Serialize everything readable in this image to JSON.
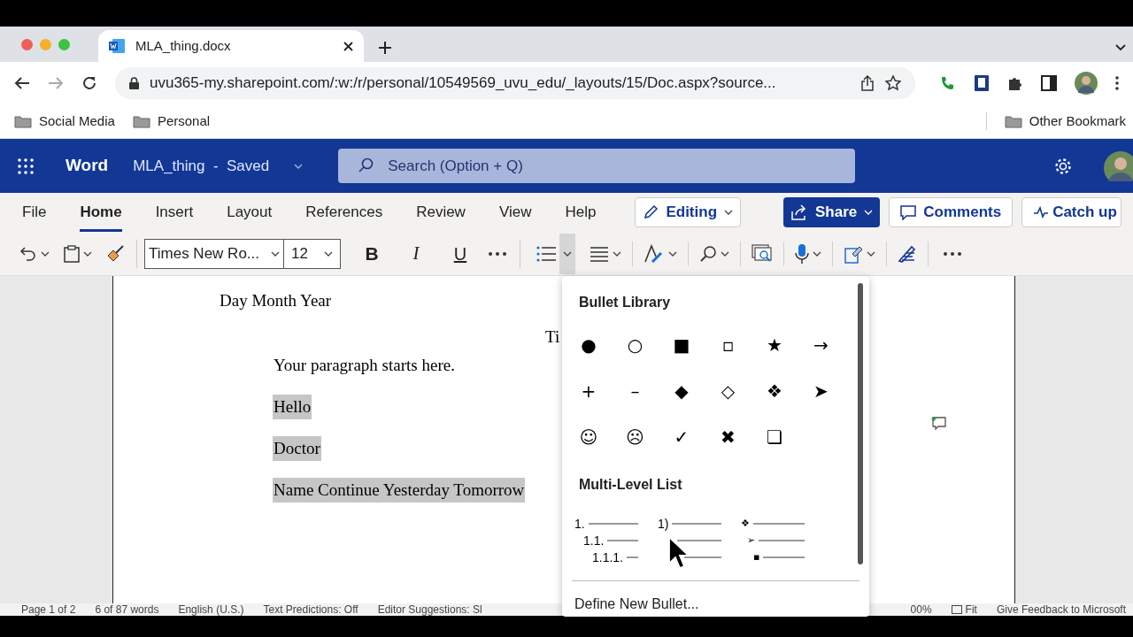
{
  "browser": {
    "tab_title": "MLA_thing.docx",
    "url": "uvu365-my.sharepoint.com/:w:/r/personal/10549569_uvu_edu/_layouts/15/Doc.aspx?source...",
    "bookmarks": [
      "Social Media",
      "Personal"
    ],
    "other_bookmarks": "Other Bookmark"
  },
  "word": {
    "app_name": "Word",
    "doc_name": "MLA_thing",
    "save_status": "-  Saved",
    "search_placeholder": "Search (Option + Q)"
  },
  "ribbon_tabs": [
    {
      "label": "File",
      "selected": false
    },
    {
      "label": "Home",
      "selected": true
    },
    {
      "label": "Insert",
      "selected": false
    },
    {
      "label": "Layout",
      "selected": false
    },
    {
      "label": "References",
      "selected": false
    },
    {
      "label": "Review",
      "selected": false
    },
    {
      "label": "View",
      "selected": false
    },
    {
      "label": "Help",
      "selected": false
    }
  ],
  "actions": {
    "editing": "Editing",
    "share": "Share",
    "comments": "Comments",
    "catch_up": "Catch up"
  },
  "toolbar": {
    "font_name": "Times New Ro...",
    "font_size": "12",
    "bold": "B",
    "italic": "I",
    "underline": "U"
  },
  "document": {
    "date": "Day Month Year",
    "title": "Ti",
    "paragraphs": [
      {
        "text": "Your paragraph starts here.",
        "selected": false
      },
      {
        "text": "Hello",
        "selected": true
      },
      {
        "text": "Doctor",
        "selected": true
      },
      {
        "text": "Name Continue Yesterday Tomorrow",
        "selected": true
      }
    ]
  },
  "bullet_menu": {
    "heading": "Bullet Library",
    "bullets": [
      "●",
      "○",
      "■",
      "▫",
      "★",
      "→",
      "+",
      "–",
      "◆",
      "◇",
      "❖",
      "➤",
      "☺",
      "☹",
      "✓",
      "✖",
      "❏"
    ],
    "multilevel_heading": "Multi-Level List",
    "multilevel": [
      {
        "markers": [
          "1.",
          "1.1.",
          "1.1.1."
        ]
      },
      {
        "markers": [
          "1)"
        ]
      },
      {
        "markers": [
          "❖",
          "➢",
          "▪"
        ]
      }
    ],
    "define_new": "Define New Bullet..."
  },
  "status_bar": [
    "Page 1 of 2",
    "6 of 87 words",
    "English (U.S.)",
    "Text Predictions: Off",
    "Editor Suggestions: Sl"
  ],
  "status_bar_right": {
    "zoom": "00%",
    "fit": "Fit",
    "feedback": "Give Feedback to Microsoft"
  }
}
